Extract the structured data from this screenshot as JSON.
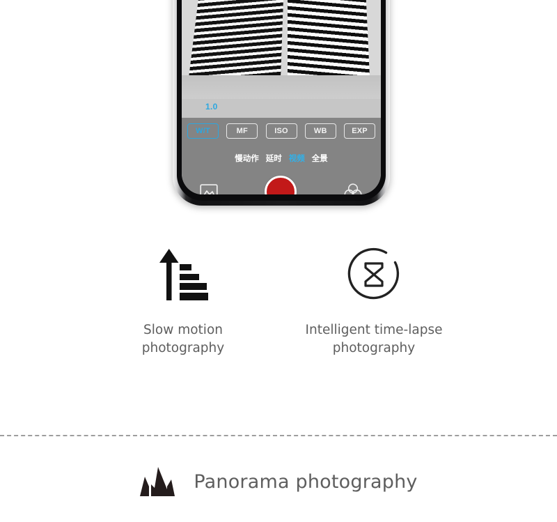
{
  "phone": {
    "screen": {
      "photo_alt": "black-and-white striped high-rise buildings",
      "zoom_value": "1.0",
      "mode_buttons": [
        {
          "label": "W/T",
          "active": true
        },
        {
          "label": "MF",
          "active": false
        },
        {
          "label": "ISO",
          "active": false
        },
        {
          "label": "WB",
          "active": false
        },
        {
          "label": "EXP",
          "active": false
        }
      ],
      "mode_tabs": [
        {
          "label": "慢动作",
          "active": false
        },
        {
          "label": "延时",
          "active": false
        },
        {
          "label": "视频",
          "active": true
        },
        {
          "label": "全景",
          "active": false
        }
      ],
      "bottom_bar": {
        "gallery_icon": "gallery-icon",
        "shutter_label": "record-button",
        "filter_icon": "color-filter-icon"
      }
    }
  },
  "features": [
    {
      "icon": "slow-motion-arrow-bars-icon",
      "label": "Slow motion photography"
    },
    {
      "icon": "hourglass-in-circle-icon",
      "label": "Intelligent time-lapse photography"
    }
  ],
  "panorama": {
    "icon": "mountains-icon",
    "label": "Panorama photography"
  },
  "colors": {
    "accent_blue": "#2ca7e0",
    "record_red": "#c21919",
    "panel_gray": "#848484",
    "text_gray": "#5e5e5e",
    "divider_gray": "#9d9d9d"
  }
}
